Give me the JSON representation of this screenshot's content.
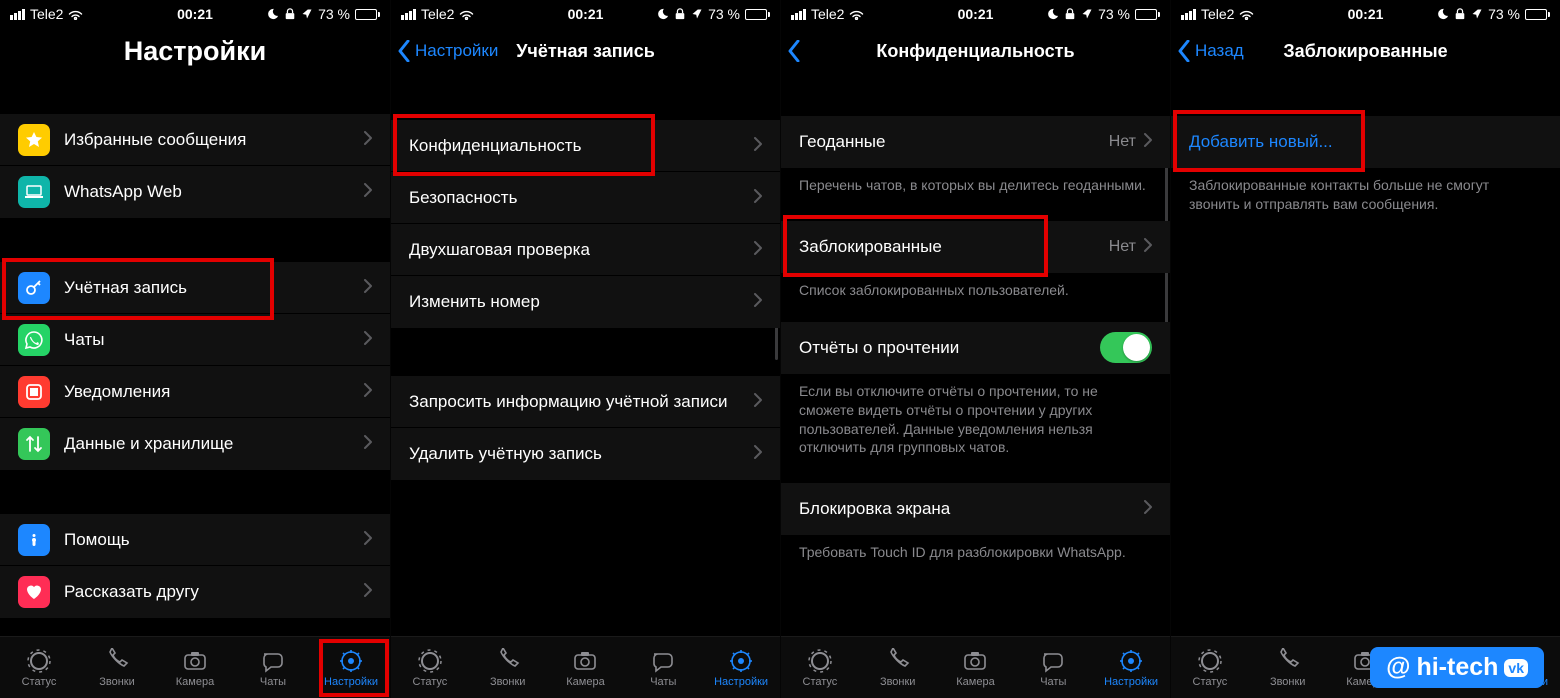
{
  "status": {
    "carrier": "Tele2",
    "time": "00:21",
    "battery_pct": "73 %"
  },
  "tabs": {
    "status": "Статус",
    "calls": "Звонки",
    "camera": "Камера",
    "chats": "Чаты",
    "settings": "Настройки"
  },
  "screen1": {
    "title": "Настройки",
    "g1": [
      {
        "label": "Избранные сообщения",
        "icon": "star",
        "bg": "#ffcc00"
      },
      {
        "label": "WhatsApp Web",
        "icon": "laptop",
        "bg": "#0fb5a9"
      }
    ],
    "g2": [
      {
        "label": "Учётная запись",
        "icon": "key",
        "bg": "#1d87ff"
      },
      {
        "label": "Чаты",
        "icon": "wa",
        "bg": "#25d366"
      },
      {
        "label": "Уведомления",
        "icon": "bell",
        "bg": "#ff3b30"
      },
      {
        "label": "Данные и хранилище",
        "icon": "data",
        "bg": "#34c759"
      }
    ],
    "g3": [
      {
        "label": "Помощь",
        "icon": "info",
        "bg": "#1d87ff"
      },
      {
        "label": "Рассказать другу",
        "icon": "heart",
        "bg": "#ff2d55"
      }
    ]
  },
  "screen2": {
    "back": "Настройки",
    "title": "Учётная запись",
    "g1": [
      "Конфиденциальность",
      "Безопасность",
      "Двухшаговая проверка",
      "Изменить номер"
    ],
    "g2": [
      "Запросить информацию учётной записи",
      "Удалить учётную запись"
    ]
  },
  "screen3": {
    "title": "Конфиденциальность",
    "geo": {
      "label": "Геоданные",
      "value": "Нет",
      "note": "Перечень чатов, в которых вы делитесь геоданными."
    },
    "blocked": {
      "label": "Заблокированные",
      "value": "Нет",
      "note": "Список заблокированных пользователей."
    },
    "receipts": {
      "label": "Отчёты о прочтении",
      "note": "Если вы отключите отчёты о прочтении, то не сможете видеть отчёты о прочтении у других пользователей. Данные уведомления нельзя отключить для групповых чатов."
    },
    "lock": {
      "label": "Блокировка экрана",
      "note": "Требовать Touch ID для разблокировки WhatsApp."
    }
  },
  "screen4": {
    "back": "Назад",
    "title": "Заблокированные",
    "add": "Добавить новый...",
    "note": "Заблокированные контакты больше не смогут звонить и отправлять вам сообщения."
  },
  "watermark": {
    "at": "@",
    "brand": "hi-tech",
    "vk": "vk"
  }
}
